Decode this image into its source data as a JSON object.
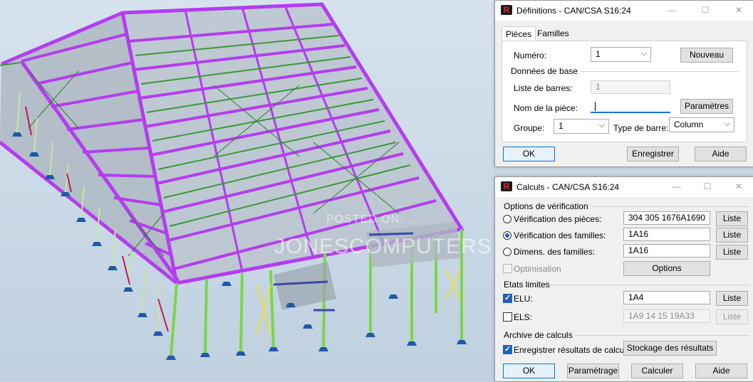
{
  "viewport": {
    "watermark_line1": "POSTED ON: ...",
    "watermark_line2": "JONESCOMPUTERS"
  },
  "definitions_dialog": {
    "title": "Définitions - CAN/CSA S16:24",
    "tabs": [
      "Pièces",
      "Familles"
    ],
    "numero_label": "Numéro:",
    "numero_value": "1",
    "nouveau_button": "Nouveau",
    "group_donnees": "Données de base",
    "liste_barres_label": "Liste de barres:",
    "liste_barres_value": "1",
    "nom_piece_label": "Nom de la pièce:",
    "nom_piece_value": "",
    "parametres_button": "Paramètres",
    "groupe_label": "Groupe:",
    "groupe_value": "1",
    "type_barre_label": "Type de barre:",
    "type_barre_value": "Column",
    "ok_button": "OK",
    "enregistrer_button": "Enregistrer",
    "aide_button": "Aide"
  },
  "calculs_dialog": {
    "title": "Calculs - CAN/CSA S16:24",
    "group_options": "Options de vérification",
    "verif_pieces_label": "Vérification des pièces:",
    "verif_pieces_value": "304 305 1676A1690",
    "verif_familles_label": "Vérification des familles:",
    "verif_familles_value": "1A16",
    "dimens_label": "Dimens. des familles:",
    "dimens_value": "1A16",
    "liste_button": "Liste",
    "optimisation_label": "Optimisation",
    "options_button": "Options",
    "group_etats": "Etats limites",
    "elu_label": "ELU:",
    "elu_value": "1A4",
    "els_label": "ELS:",
    "els_value": "1A9 14 15 19A33",
    "group_archive": "Archive de calculs",
    "enregistrer_resultats_label": "Enregistrer résultats de calculs",
    "stockage_button": "Stockage des résultats",
    "ok_button": "OK",
    "parametrage_button": "Paramétrage",
    "calculer_button": "Calculer",
    "aide_button": "Aide"
  },
  "colors": {
    "beam_primary": "#b53cf0",
    "beam_secondary": "#3a9a36",
    "column": "#7bd64a",
    "roof_panel": "#b9c3cc",
    "bracing": "#c2185b"
  }
}
